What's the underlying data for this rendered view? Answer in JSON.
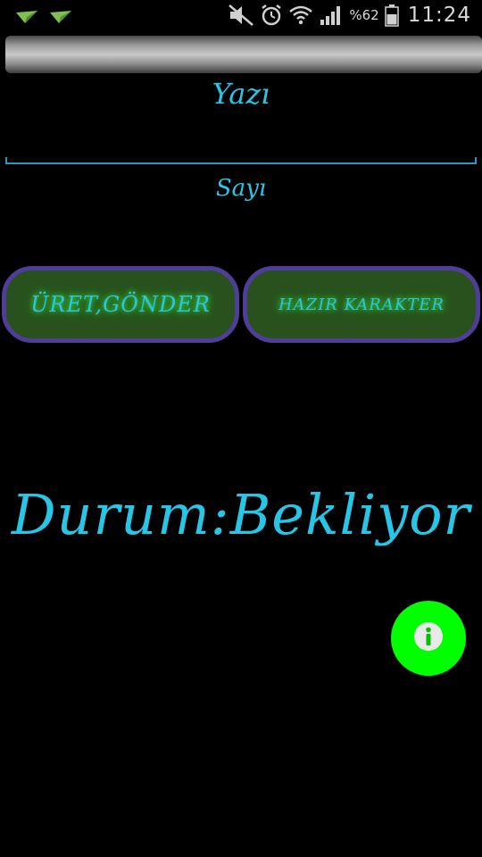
{
  "status_bar": {
    "battery_percent": "%62",
    "time": "11:24",
    "left_icons": [
      "paper-plane-notification-icon",
      "paper-plane-notification-icon"
    ],
    "right_icons": [
      "mute-icon",
      "alarm-icon",
      "wifi-icon",
      "signal-icon",
      "battery-icon"
    ]
  },
  "form": {
    "yazi_label": "Yazı",
    "yazi_value": "",
    "sayi_label": "Sayı"
  },
  "buttons": {
    "uret_label": "ÜRET,GÖNDER",
    "hazir_label": "HAZIR KARAKTER"
  },
  "status": {
    "text": "Durum:Bekliyor"
  },
  "fab": {
    "icon": "info-icon"
  },
  "colors": {
    "accent_text": "#27c6e6",
    "button_fill": "#28511e",
    "button_border": "#4f3d99",
    "fab": "#00ff00",
    "underline": "#2f97c6"
  }
}
